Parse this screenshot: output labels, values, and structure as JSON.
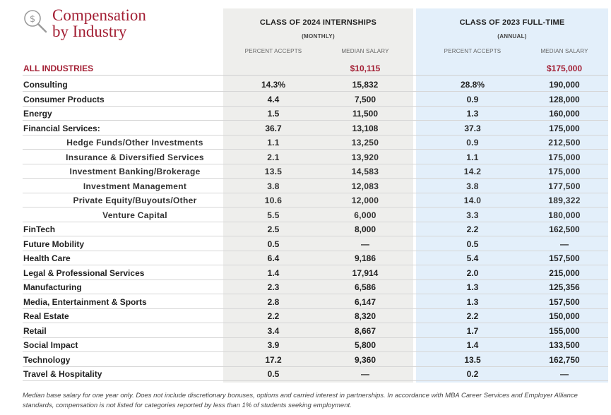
{
  "title": "Compensation\nby Industry",
  "internship": {
    "heading": "CLASS OF 2024 INTERNSHIPS",
    "subheading": "(MONTHLY)",
    "col_percent": "PERCENT ACCEPTS",
    "col_salary": "MEDIAN SALARY"
  },
  "fulltime": {
    "heading": "CLASS OF 2023 FULL-TIME",
    "subheading": "(ANNUAL)",
    "col_percent": "PERCENT ACCEPTS",
    "col_salary": "MEDIAN SALARY"
  },
  "all_industries": {
    "label": "ALL INDUSTRIES",
    "intern_pct": "",
    "intern_salary": "$10,115",
    "ft_pct": "",
    "ft_salary": "$175,000"
  },
  "rows": [
    {
      "label": "Consulting",
      "type": "main",
      "intern_pct": "14.3%",
      "intern_salary": "15,832",
      "ft_pct": "28.8%",
      "ft_salary": "190,000"
    },
    {
      "label": "Consumer Products",
      "type": "main",
      "intern_pct": "4.4",
      "intern_salary": "7,500",
      "ft_pct": "0.9",
      "ft_salary": "128,000"
    },
    {
      "label": "Energy",
      "type": "main",
      "intern_pct": "1.5",
      "intern_salary": "11,500",
      "ft_pct": "1.3",
      "ft_salary": "160,000"
    },
    {
      "label": "Financial Services:",
      "type": "main",
      "intern_pct": "36.7",
      "intern_salary": "13,108",
      "ft_pct": "37.3",
      "ft_salary": "175,000"
    },
    {
      "label": "Hedge Funds/Other Investments",
      "type": "sub",
      "intern_pct": "1.1",
      "intern_salary": "13,250",
      "ft_pct": "0.9",
      "ft_salary": "212,500"
    },
    {
      "label": "Insurance & Diversified Services",
      "type": "sub",
      "intern_pct": "2.1",
      "intern_salary": "13,920",
      "ft_pct": "1.1",
      "ft_salary": "175,000"
    },
    {
      "label": "Investment Banking/Brokerage",
      "type": "sub",
      "intern_pct": "13.5",
      "intern_salary": "14,583",
      "ft_pct": "14.2",
      "ft_salary": "175,000"
    },
    {
      "label": "Investment Management",
      "type": "sub",
      "intern_pct": "3.8",
      "intern_salary": "12,083",
      "ft_pct": "3.8",
      "ft_salary": "177,500"
    },
    {
      "label": "Private Equity/Buyouts/Other",
      "type": "sub",
      "intern_pct": "10.6",
      "intern_salary": "12,000",
      "ft_pct": "14.0",
      "ft_salary": "189,322"
    },
    {
      "label": "Venture Capital",
      "type": "sub",
      "intern_pct": "5.5",
      "intern_salary": "6,000",
      "ft_pct": "3.3",
      "ft_salary": "180,000"
    },
    {
      "label": "FinTech",
      "type": "main",
      "intern_pct": "2.5",
      "intern_salary": "8,000",
      "ft_pct": "2.2",
      "ft_salary": "162,500"
    },
    {
      "label": "Future Mobility",
      "type": "main",
      "intern_pct": "0.5",
      "intern_salary": "—",
      "ft_pct": "0.5",
      "ft_salary": "—"
    },
    {
      "label": "Health Care",
      "type": "main",
      "intern_pct": "6.4",
      "intern_salary": "9,186",
      "ft_pct": "5.4",
      "ft_salary": "157,500"
    },
    {
      "label": "Legal & Professional Services",
      "type": "main",
      "intern_pct": "1.4",
      "intern_salary": "17,914",
      "ft_pct": "2.0",
      "ft_salary": "215,000"
    },
    {
      "label": "Manufacturing",
      "type": "main",
      "intern_pct": "2.3",
      "intern_salary": "6,586",
      "ft_pct": "1.3",
      "ft_salary": "125,356"
    },
    {
      "label": "Media, Entertainment & Sports",
      "type": "main",
      "intern_pct": "2.8",
      "intern_salary": "6,147",
      "ft_pct": "1.3",
      "ft_salary": "157,500"
    },
    {
      "label": "Real Estate",
      "type": "main",
      "intern_pct": "2.2",
      "intern_salary": "8,320",
      "ft_pct": "2.2",
      "ft_salary": "150,000"
    },
    {
      "label": "Retail",
      "type": "main",
      "intern_pct": "3.4",
      "intern_salary": "8,667",
      "ft_pct": "1.7",
      "ft_salary": "155,000"
    },
    {
      "label": "Social Impact",
      "type": "main",
      "intern_pct": "3.9",
      "intern_salary": "5,800",
      "ft_pct": "1.4",
      "ft_salary": "133,500"
    },
    {
      "label": "Technology",
      "type": "main",
      "intern_pct": "17.2",
      "intern_salary": "9,360",
      "ft_pct": "13.5",
      "ft_salary": "162,750"
    },
    {
      "label": "Travel & Hospitality",
      "type": "main",
      "intern_pct": "0.5",
      "intern_salary": "—",
      "ft_pct": "0.2",
      "ft_salary": "—"
    }
  ],
  "footnote": "Median base salary for one year only. Does not include discretionary bonuses, options and carried interest in partnerships. In accordance with MBA Career Services and Employer Alliance standards, compensation is not listed for categories reported by less than 1% of students seeking employment.",
  "colors": {
    "accent": "#a31f34",
    "intern_bg": "#eeeeec",
    "fulltime_bg": "#e3effa"
  },
  "icons": {
    "title": "salary-search-icon"
  }
}
